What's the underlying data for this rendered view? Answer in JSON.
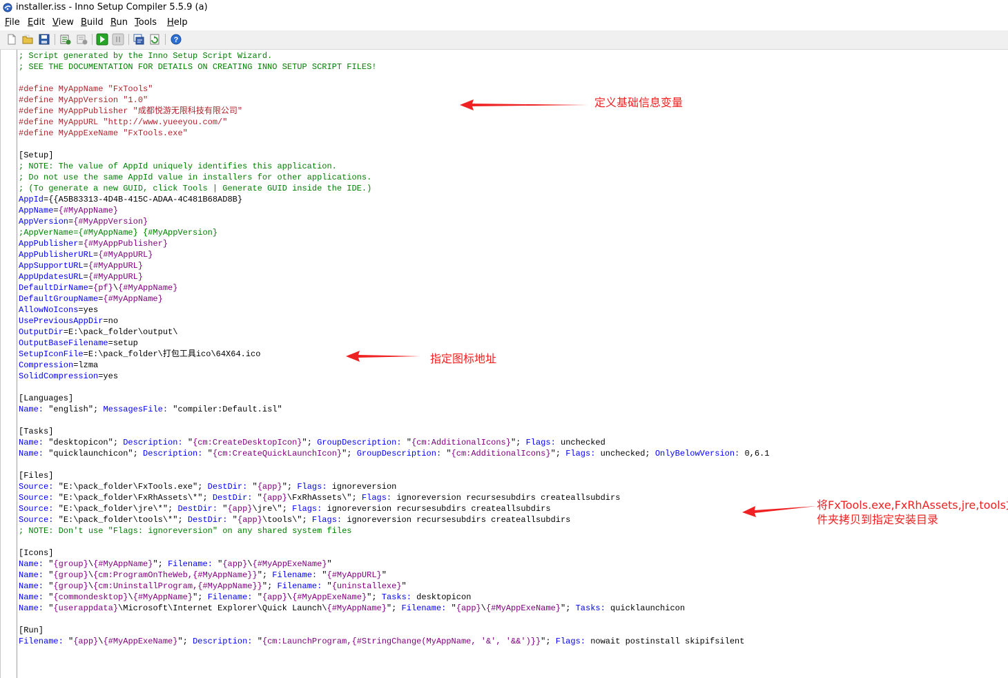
{
  "window": {
    "title": "installer.iss - Inno Setup Compiler 5.5.9 (a)"
  },
  "menu": [
    {
      "mnemonic": "F",
      "rest": "ile"
    },
    {
      "mnemonic": "E",
      "rest": "dit"
    },
    {
      "mnemonic": "V",
      "rest": "iew"
    },
    {
      "mnemonic": "B",
      "rest": "uild"
    },
    {
      "mnemonic": "R",
      "rest": "un"
    },
    {
      "mnemonic": "T",
      "rest": "ools"
    },
    {
      "mnemonic": "H",
      "rest": "elp"
    }
  ],
  "toolbar": [
    {
      "icon": "new-file-icon",
      "color": "#ffffff"
    },
    {
      "icon": "open-folder-icon",
      "color": "#e8c34a"
    },
    {
      "icon": "save-icon",
      "color": "#2f5fa8"
    },
    {
      "icon": "compile-icon",
      "color": "#3a8a3a"
    },
    {
      "icon": "stop-compile-icon",
      "color": "#9a9a9a"
    },
    {
      "icon": "run-icon",
      "color": "#27a527"
    },
    {
      "icon": "pause-icon",
      "color": "#a8a8a8"
    },
    {
      "icon": "target-setup-icon",
      "color": "#3a62b0"
    },
    {
      "icon": "target-uninstall-icon",
      "color": "#3a9a3a"
    },
    {
      "icon": "help-icon",
      "color": "#2d6fd0"
    }
  ],
  "colors": {
    "comment": "#008000",
    "directive": "#b2232b",
    "key": "#0000ff",
    "constant": "#800080",
    "annotation": "#ee2222"
  },
  "editor": {
    "lines": [
      [
        {
          "t": "comment",
          "s": "; Script generated by the Inno Setup Script Wizard."
        }
      ],
      [
        {
          "t": "comment",
          "s": "; SEE THE DOCUMENTATION FOR DETAILS ON CREATING INNO SETUP SCRIPT FILES!"
        }
      ],
      [],
      [
        {
          "t": "directive",
          "s": "#define MyAppName \"FxTools\""
        }
      ],
      [
        {
          "t": "directive",
          "s": "#define MyAppVersion \"1.0\""
        }
      ],
      [
        {
          "t": "directive",
          "s": "#define MyAppPublisher \"成都悦游无限科技有限公司\""
        }
      ],
      [
        {
          "t": "directive",
          "s": "#define MyAppURL \"http://www.yueeyou.com/\""
        }
      ],
      [
        {
          "t": "directive",
          "s": "#define MyAppExeName \"FxTools.exe\""
        }
      ],
      [],
      [
        {
          "t": "section",
          "s": "[Setup]"
        }
      ],
      [
        {
          "t": "comment",
          "s": "; NOTE: The value of AppId uniquely identifies this application."
        }
      ],
      [
        {
          "t": "comment",
          "s": "; Do not use the same AppId value in installers for other applications."
        }
      ],
      [
        {
          "t": "comment",
          "s": "; (To generate a new GUID, click Tools | Generate GUID inside the IDE.)"
        }
      ],
      [
        {
          "t": "key",
          "s": "AppId"
        },
        {
          "t": "text",
          "s": "={{A5B83313-4D4B-415C-ADAA-4C481B68AD8B}"
        }
      ],
      [
        {
          "t": "key",
          "s": "AppName"
        },
        {
          "t": "text",
          "s": "="
        },
        {
          "t": "const",
          "s": "{#MyAppName}"
        }
      ],
      [
        {
          "t": "key",
          "s": "AppVersion"
        },
        {
          "t": "text",
          "s": "="
        },
        {
          "t": "const",
          "s": "{#MyAppVersion}"
        }
      ],
      [
        {
          "t": "comment",
          "s": ";AppVerName={#MyAppName} {#MyAppVersion}"
        }
      ],
      [
        {
          "t": "key",
          "s": "AppPublisher"
        },
        {
          "t": "text",
          "s": "="
        },
        {
          "t": "const",
          "s": "{#MyAppPublisher}"
        }
      ],
      [
        {
          "t": "key",
          "s": "AppPublisherURL"
        },
        {
          "t": "text",
          "s": "="
        },
        {
          "t": "const",
          "s": "{#MyAppURL}"
        }
      ],
      [
        {
          "t": "key",
          "s": "AppSupportURL"
        },
        {
          "t": "text",
          "s": "="
        },
        {
          "t": "const",
          "s": "{#MyAppURL}"
        }
      ],
      [
        {
          "t": "key",
          "s": "AppUpdatesURL"
        },
        {
          "t": "text",
          "s": "="
        },
        {
          "t": "const",
          "s": "{#MyAppURL}"
        }
      ],
      [
        {
          "t": "key",
          "s": "DefaultDirName"
        },
        {
          "t": "text",
          "s": "="
        },
        {
          "t": "const",
          "s": "{pf}"
        },
        {
          "t": "text",
          "s": "\\"
        },
        {
          "t": "const",
          "s": "{#MyAppName}"
        }
      ],
      [
        {
          "t": "key",
          "s": "DefaultGroupName"
        },
        {
          "t": "text",
          "s": "="
        },
        {
          "t": "const",
          "s": "{#MyAppName}"
        }
      ],
      [
        {
          "t": "key",
          "s": "AllowNoIcons"
        },
        {
          "t": "text",
          "s": "=yes"
        }
      ],
      [
        {
          "t": "key",
          "s": "UsePreviousAppDir"
        },
        {
          "t": "text",
          "s": "=no"
        }
      ],
      [
        {
          "t": "key",
          "s": "OutputDir"
        },
        {
          "t": "text",
          "s": "=E:\\pack_folder\\output\\"
        }
      ],
      [
        {
          "t": "key",
          "s": "OutputBaseFilename"
        },
        {
          "t": "text",
          "s": "=setup"
        }
      ],
      [
        {
          "t": "key",
          "s": "SetupIconFile"
        },
        {
          "t": "text",
          "s": "=E:\\pack_folder\\打包工具ico\\64X64.ico"
        }
      ],
      [
        {
          "t": "key",
          "s": "Compression"
        },
        {
          "t": "text",
          "s": "=lzma"
        }
      ],
      [
        {
          "t": "key",
          "s": "SolidCompression"
        },
        {
          "t": "text",
          "s": "=yes"
        }
      ],
      [],
      [
        {
          "t": "section",
          "s": "[Languages]"
        }
      ],
      [
        {
          "t": "key",
          "s": "Name:"
        },
        {
          "t": "text",
          "s": " \"english\"; "
        },
        {
          "t": "key",
          "s": "MessagesFile:"
        },
        {
          "t": "text",
          "s": " \"compiler:Default.isl\""
        }
      ],
      [],
      [
        {
          "t": "section",
          "s": "[Tasks]"
        }
      ],
      [
        {
          "t": "key",
          "s": "Name:"
        },
        {
          "t": "text",
          "s": " \"desktopicon\"; "
        },
        {
          "t": "key",
          "s": "Description:"
        },
        {
          "t": "text",
          "s": " \""
        },
        {
          "t": "const",
          "s": "{cm:CreateDesktopIcon}"
        },
        {
          "t": "text",
          "s": "\"; "
        },
        {
          "t": "key",
          "s": "GroupDescription:"
        },
        {
          "t": "text",
          "s": " \""
        },
        {
          "t": "const",
          "s": "{cm:AdditionalIcons}"
        },
        {
          "t": "text",
          "s": "\"; "
        },
        {
          "t": "key",
          "s": "Flags:"
        },
        {
          "t": "text",
          "s": " unchecked"
        }
      ],
      [
        {
          "t": "key",
          "s": "Name:"
        },
        {
          "t": "text",
          "s": " \"quicklaunchicon\"; "
        },
        {
          "t": "key",
          "s": "Description:"
        },
        {
          "t": "text",
          "s": " \""
        },
        {
          "t": "const",
          "s": "{cm:CreateQuickLaunchIcon}"
        },
        {
          "t": "text",
          "s": "\"; "
        },
        {
          "t": "key",
          "s": "GroupDescription:"
        },
        {
          "t": "text",
          "s": " \""
        },
        {
          "t": "const",
          "s": "{cm:AdditionalIcons}"
        },
        {
          "t": "text",
          "s": "\"; "
        },
        {
          "t": "key",
          "s": "Flags:"
        },
        {
          "t": "text",
          "s": " unchecked; "
        },
        {
          "t": "key",
          "s": "OnlyBelowVersion:"
        },
        {
          "t": "text",
          "s": " 0,6.1"
        }
      ],
      [],
      [
        {
          "t": "section",
          "s": "[Files]"
        }
      ],
      [
        {
          "t": "key",
          "s": "Source:"
        },
        {
          "t": "text",
          "s": " \"E:\\pack_folder\\FxTools.exe\"; "
        },
        {
          "t": "key",
          "s": "DestDir:"
        },
        {
          "t": "text",
          "s": " \""
        },
        {
          "t": "const",
          "s": "{app}"
        },
        {
          "t": "text",
          "s": "\"; "
        },
        {
          "t": "key",
          "s": "Flags:"
        },
        {
          "t": "text",
          "s": " ignoreversion"
        }
      ],
      [
        {
          "t": "key",
          "s": "Source:"
        },
        {
          "t": "text",
          "s": " \"E:\\pack_folder\\FxRhAssets\\*\"; "
        },
        {
          "t": "key",
          "s": "DestDir:"
        },
        {
          "t": "text",
          "s": " \""
        },
        {
          "t": "const",
          "s": "{app}"
        },
        {
          "t": "text",
          "s": "\\FxRhAssets\\\"; "
        },
        {
          "t": "key",
          "s": "Flags:"
        },
        {
          "t": "text",
          "s": " ignoreversion recursesubdirs createallsubdirs"
        }
      ],
      [
        {
          "t": "key",
          "s": "Source:"
        },
        {
          "t": "text",
          "s": " \"E:\\pack_folder\\jre\\*\"; "
        },
        {
          "t": "key",
          "s": "DestDir:"
        },
        {
          "t": "text",
          "s": " \""
        },
        {
          "t": "const",
          "s": "{app}"
        },
        {
          "t": "text",
          "s": "\\jre\\\"; "
        },
        {
          "t": "key",
          "s": "Flags:"
        },
        {
          "t": "text",
          "s": " ignoreversion recursesubdirs createallsubdirs"
        }
      ],
      [
        {
          "t": "key",
          "s": "Source:"
        },
        {
          "t": "text",
          "s": " \"E:\\pack_folder\\tools\\*\"; "
        },
        {
          "t": "key",
          "s": "DestDir:"
        },
        {
          "t": "text",
          "s": " \""
        },
        {
          "t": "const",
          "s": "{app}"
        },
        {
          "t": "text",
          "s": "\\tools\\\"; "
        },
        {
          "t": "key",
          "s": "Flags:"
        },
        {
          "t": "text",
          "s": " ignoreversion recursesubdirs createallsubdirs"
        }
      ],
      [
        {
          "t": "comment",
          "s": "; NOTE: Don't use \"Flags: ignoreversion\" on any shared system files"
        }
      ],
      [],
      [
        {
          "t": "section",
          "s": "[Icons]"
        }
      ],
      [
        {
          "t": "key",
          "s": "Name:"
        },
        {
          "t": "text",
          "s": " \""
        },
        {
          "t": "const",
          "s": "{group}"
        },
        {
          "t": "text",
          "s": "\\"
        },
        {
          "t": "const",
          "s": "{#MyAppName}"
        },
        {
          "t": "text",
          "s": "\"; "
        },
        {
          "t": "key",
          "s": "Filename:"
        },
        {
          "t": "text",
          "s": " \""
        },
        {
          "t": "const",
          "s": "{app}"
        },
        {
          "t": "text",
          "s": "\\"
        },
        {
          "t": "const",
          "s": "{#MyAppExeName}"
        },
        {
          "t": "text",
          "s": "\""
        }
      ],
      [
        {
          "t": "key",
          "s": "Name:"
        },
        {
          "t": "text",
          "s": " \""
        },
        {
          "t": "const",
          "s": "{group}"
        },
        {
          "t": "text",
          "s": "\\"
        },
        {
          "t": "const",
          "s": "{cm:ProgramOnTheWeb,{#MyAppName}}"
        },
        {
          "t": "text",
          "s": "\"; "
        },
        {
          "t": "key",
          "s": "Filename:"
        },
        {
          "t": "text",
          "s": " \""
        },
        {
          "t": "const",
          "s": "{#MyAppURL}"
        },
        {
          "t": "text",
          "s": "\""
        }
      ],
      [
        {
          "t": "key",
          "s": "Name:"
        },
        {
          "t": "text",
          "s": " \""
        },
        {
          "t": "const",
          "s": "{group}"
        },
        {
          "t": "text",
          "s": "\\"
        },
        {
          "t": "const",
          "s": "{cm:UninstallProgram,{#MyAppName}}"
        },
        {
          "t": "text",
          "s": "\"; "
        },
        {
          "t": "key",
          "s": "Filename:"
        },
        {
          "t": "text",
          "s": " \""
        },
        {
          "t": "const",
          "s": "{uninstallexe}"
        },
        {
          "t": "text",
          "s": "\""
        }
      ],
      [
        {
          "t": "key",
          "s": "Name:"
        },
        {
          "t": "text",
          "s": " \""
        },
        {
          "t": "const",
          "s": "{commondesktop}"
        },
        {
          "t": "text",
          "s": "\\"
        },
        {
          "t": "const",
          "s": "{#MyAppName}"
        },
        {
          "t": "text",
          "s": "\"; "
        },
        {
          "t": "key",
          "s": "Filename:"
        },
        {
          "t": "text",
          "s": " \""
        },
        {
          "t": "const",
          "s": "{app}"
        },
        {
          "t": "text",
          "s": "\\"
        },
        {
          "t": "const",
          "s": "{#MyAppExeName}"
        },
        {
          "t": "text",
          "s": "\"; "
        },
        {
          "t": "key",
          "s": "Tasks:"
        },
        {
          "t": "text",
          "s": " desktopicon"
        }
      ],
      [
        {
          "t": "key",
          "s": "Name:"
        },
        {
          "t": "text",
          "s": " \""
        },
        {
          "t": "const",
          "s": "{userappdata}"
        },
        {
          "t": "text",
          "s": "\\Microsoft\\Internet Explorer\\Quick Launch\\"
        },
        {
          "t": "const",
          "s": "{#MyAppName}"
        },
        {
          "t": "text",
          "s": "\"; "
        },
        {
          "t": "key",
          "s": "Filename:"
        },
        {
          "t": "text",
          "s": " \""
        },
        {
          "t": "const",
          "s": "{app}"
        },
        {
          "t": "text",
          "s": "\\"
        },
        {
          "t": "const",
          "s": "{#MyAppExeName}"
        },
        {
          "t": "text",
          "s": "\"; "
        },
        {
          "t": "key",
          "s": "Tasks:"
        },
        {
          "t": "text",
          "s": " quicklaunchicon"
        }
      ],
      [],
      [
        {
          "t": "section",
          "s": "[Run]"
        }
      ],
      [
        {
          "t": "key",
          "s": "Filename:"
        },
        {
          "t": "text",
          "s": " \""
        },
        {
          "t": "const",
          "s": "{app}"
        },
        {
          "t": "text",
          "s": "\\"
        },
        {
          "t": "const",
          "s": "{#MyAppExeName}"
        },
        {
          "t": "text",
          "s": "\"; "
        },
        {
          "t": "key",
          "s": "Description:"
        },
        {
          "t": "text",
          "s": " \""
        },
        {
          "t": "const",
          "s": "{cm:LaunchProgram,{#StringChange(MyAppName, '&', '&&')}}"
        },
        {
          "t": "text",
          "s": "\"; "
        },
        {
          "t": "key",
          "s": "Flags:"
        },
        {
          "t": "text",
          "s": " nowait postinstall skipifsilent"
        }
      ]
    ]
  },
  "annotations": {
    "define_vars": "定义基础信息变量",
    "icon_path": "指定图标地址",
    "copy_files_1": "将FxTools.exe,FxRhAssets,jre,tools文",
    "copy_files_2": "件夹拷贝到指定安装目录"
  }
}
